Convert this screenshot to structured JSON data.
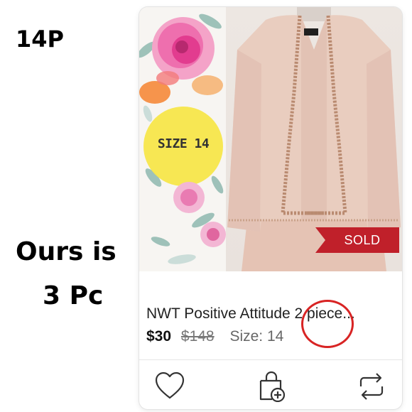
{
  "annotations": {
    "size_note": "14P",
    "line1": "Ours is",
    "line2": "3 Pc"
  },
  "listing": {
    "photo_overlay_text": "SIZE 14",
    "sold_badge": "SOLD",
    "title": "NWT Positive Attitude 2 piece...",
    "price": "$30",
    "original_price": "$148",
    "size": "Size: 14"
  },
  "actions": {
    "like_icon": "heart-icon",
    "bundle_icon": "bag-plus-icon",
    "share_icon": "share-arrows-icon"
  },
  "colors": {
    "sold_banner": "#c0202a",
    "highlight_circle": "#d82424",
    "jacket": "#e8cbbd",
    "yellow_badge": "#f7e64a"
  }
}
